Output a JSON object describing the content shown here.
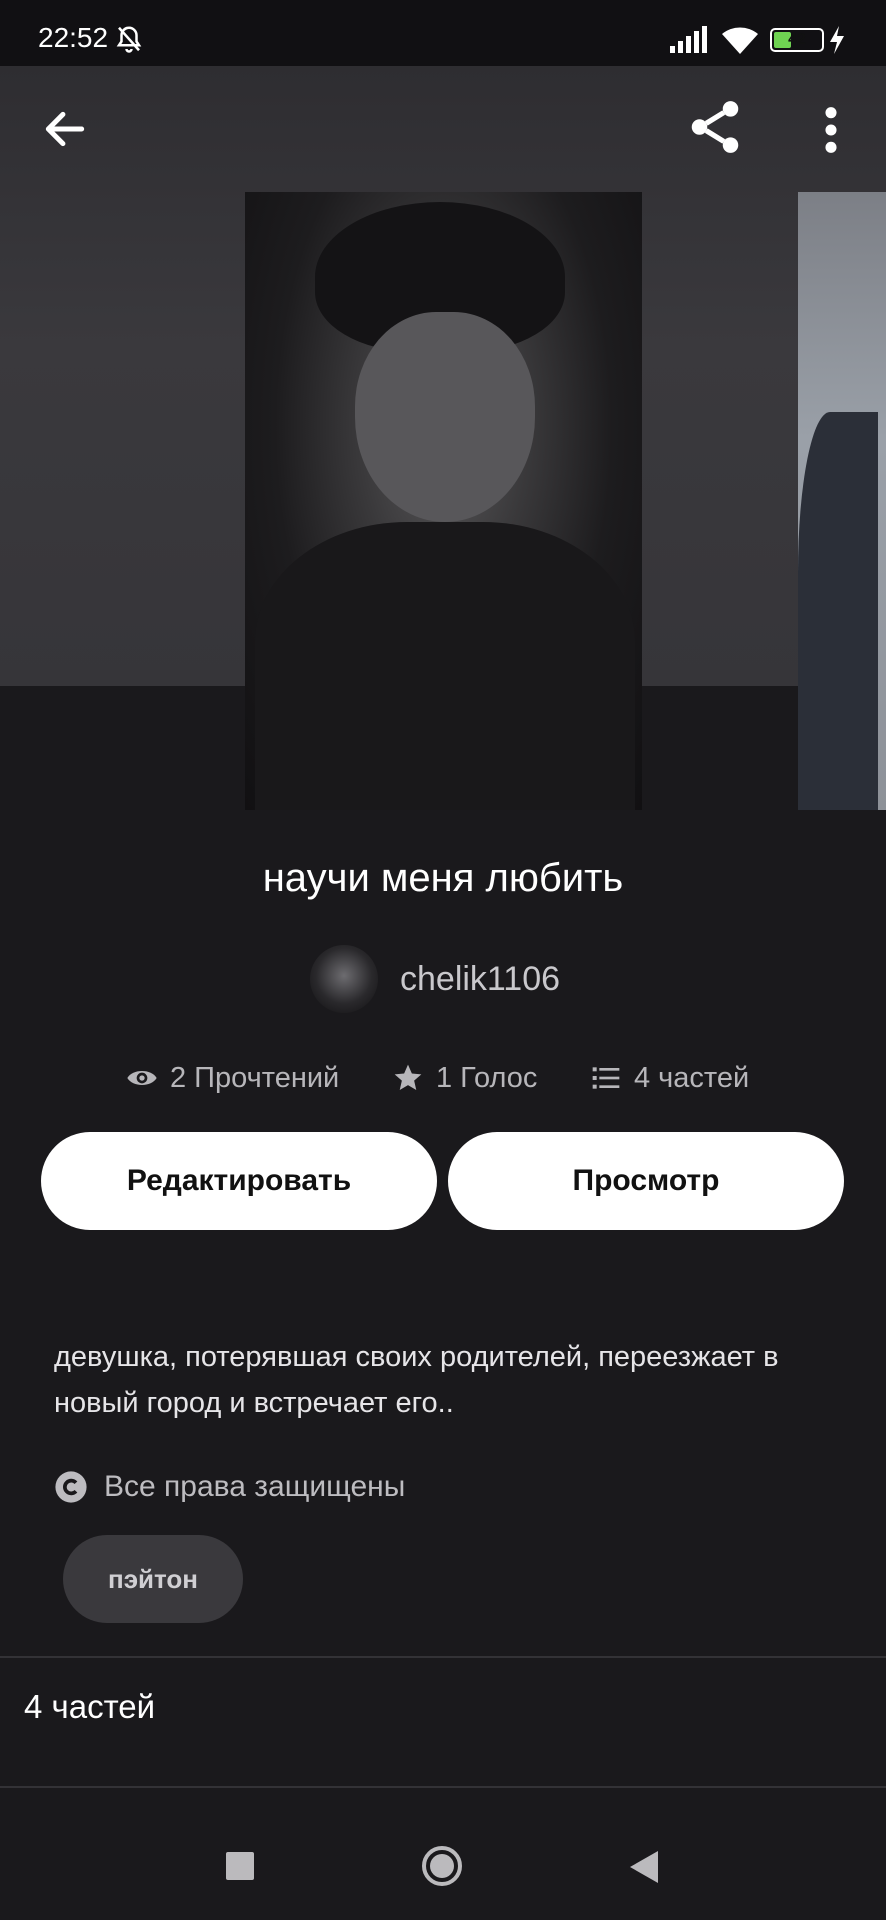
{
  "status_bar": {
    "time": "22:52",
    "battery": "42",
    "battery_level": 0.42
  },
  "story": {
    "title": "научи меня любить",
    "author": "chelik1106",
    "stats": {
      "reads": "2 Прочтений",
      "votes": "1 Голос",
      "parts": "4 частей"
    },
    "description": "девушка, потерявшая своих родителей, переезжает в новый город и встречает его..",
    "copyright": "Все права защищены",
    "tag": "пэйтон"
  },
  "actions": {
    "edit_label": "Редактировать",
    "preview_label": "Просмотр"
  },
  "parts_section": {
    "label": "4 частей"
  },
  "icons": {
    "back": "arrow-left-icon",
    "share": "share-icon",
    "more": "more-vertical-icon",
    "reads": "eye-icon",
    "votes": "star-icon",
    "parts": "list-icon",
    "copyright": "copyright-icon"
  },
  "colors": {
    "background": "#1a191c",
    "button_bg": "#ffffff",
    "tag_bg": "#3a393d"
  }
}
